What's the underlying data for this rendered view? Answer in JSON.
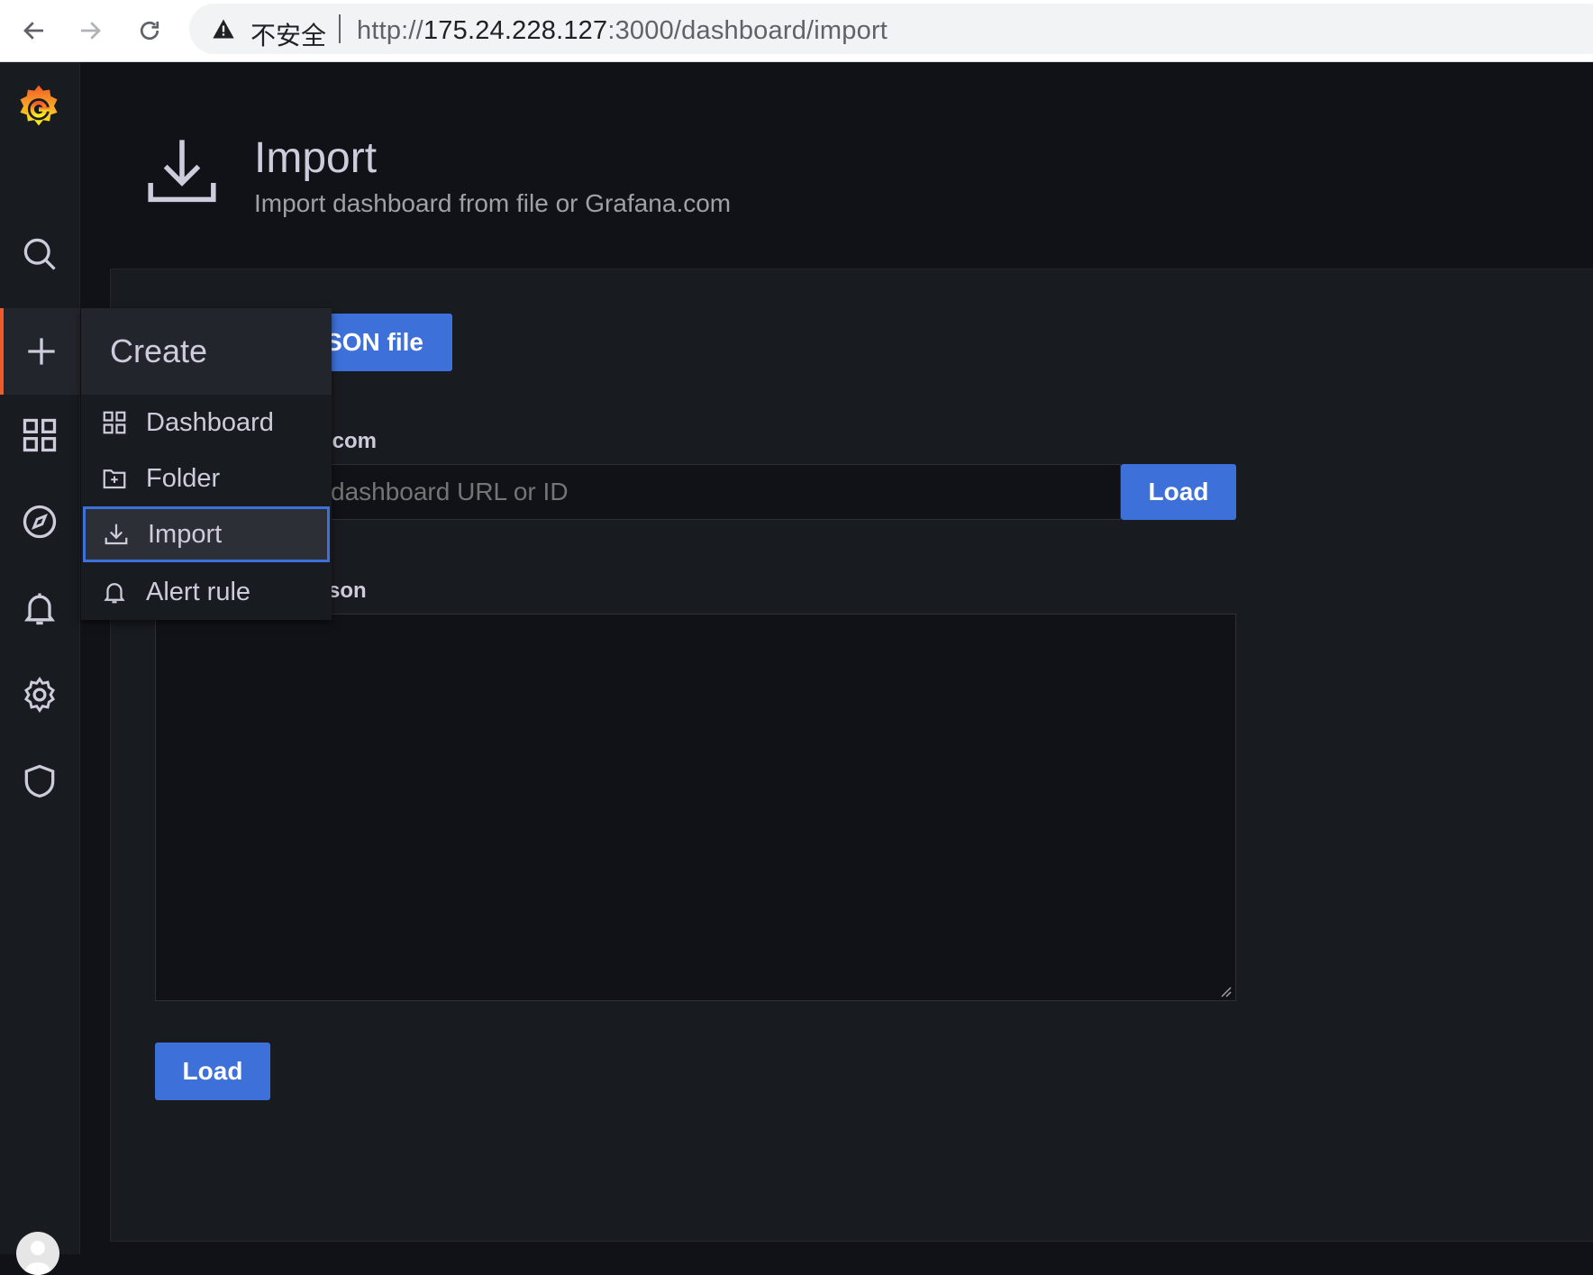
{
  "browser": {
    "insecure_label": "不安全",
    "url_scheme": "http://",
    "url_host": "175.24.228.127",
    "url_path": ":3000/dashboard/import"
  },
  "sidebar": {
    "items": [
      {
        "name": "search",
        "icon": "search-icon"
      },
      {
        "name": "create",
        "icon": "plus-icon",
        "active": true
      },
      {
        "name": "dashboards",
        "icon": "apps-icon"
      },
      {
        "name": "explore",
        "icon": "compass-icon"
      },
      {
        "name": "alerting",
        "icon": "bell-icon"
      },
      {
        "name": "configuration",
        "icon": "gear-icon"
      },
      {
        "name": "server-admin",
        "icon": "shield-icon"
      }
    ]
  },
  "header": {
    "title": "Import",
    "subtitle": "Import dashboard from file or Grafana.com"
  },
  "import_form": {
    "upload_label": "SON file",
    "gcom_label": ".com",
    "gcom_placeholder": "dashboard URL or ID",
    "gcom_load_label": "Load",
    "json_label": "son",
    "json_value": "",
    "load_label": "Load"
  },
  "create_menu": {
    "title": "Create",
    "items": [
      {
        "label": "Dashboard",
        "icon": "apps-icon"
      },
      {
        "label": "Folder",
        "icon": "folder-plus-icon"
      },
      {
        "label": "Import",
        "icon": "import-icon",
        "focused": true
      },
      {
        "label": "Alert rule",
        "icon": "bell-icon"
      }
    ]
  },
  "colors": {
    "accent": "#3d71d9",
    "brand": "#f05a28",
    "panel": "#181b1f",
    "background": "#111217"
  }
}
